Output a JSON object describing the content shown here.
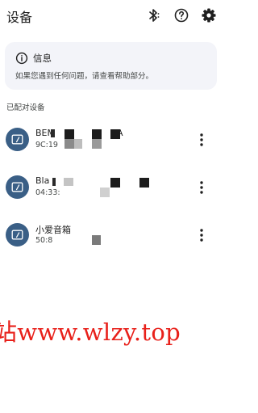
{
  "header": {
    "title": "设备",
    "bluetooth_icon": "bluetooth-icon",
    "help_icon": "help-circle-icon",
    "settings_icon": "gear-icon"
  },
  "info_card": {
    "icon": "info-icon",
    "title": "信息",
    "description": "如果您遇到任何问题，请查看帮助部分。"
  },
  "paired_section": {
    "label": "已配对设备",
    "devices": [
      {
        "name": "BEM",
        "name_tail": "'A",
        "address": "9C:19",
        "icon": "tablet-device-icon",
        "menu_icon": "more-vertical-icon"
      },
      {
        "name": "Bla",
        "name_tail": "",
        "address": "04:33:",
        "icon": "tablet-device-icon",
        "menu_icon": "more-vertical-icon"
      },
      {
        "name": "小爱音箱",
        "name_tail": "",
        "address": "50:8",
        "icon": "tablet-device-icon",
        "menu_icon": "more-vertical-icon"
      }
    ]
  },
  "watermark": "站www.wlzy.top",
  "colors": {
    "accent_dark_blue": "#3a5f86",
    "card_background": "#f3f4f9",
    "watermark_red": "#e8201a"
  }
}
